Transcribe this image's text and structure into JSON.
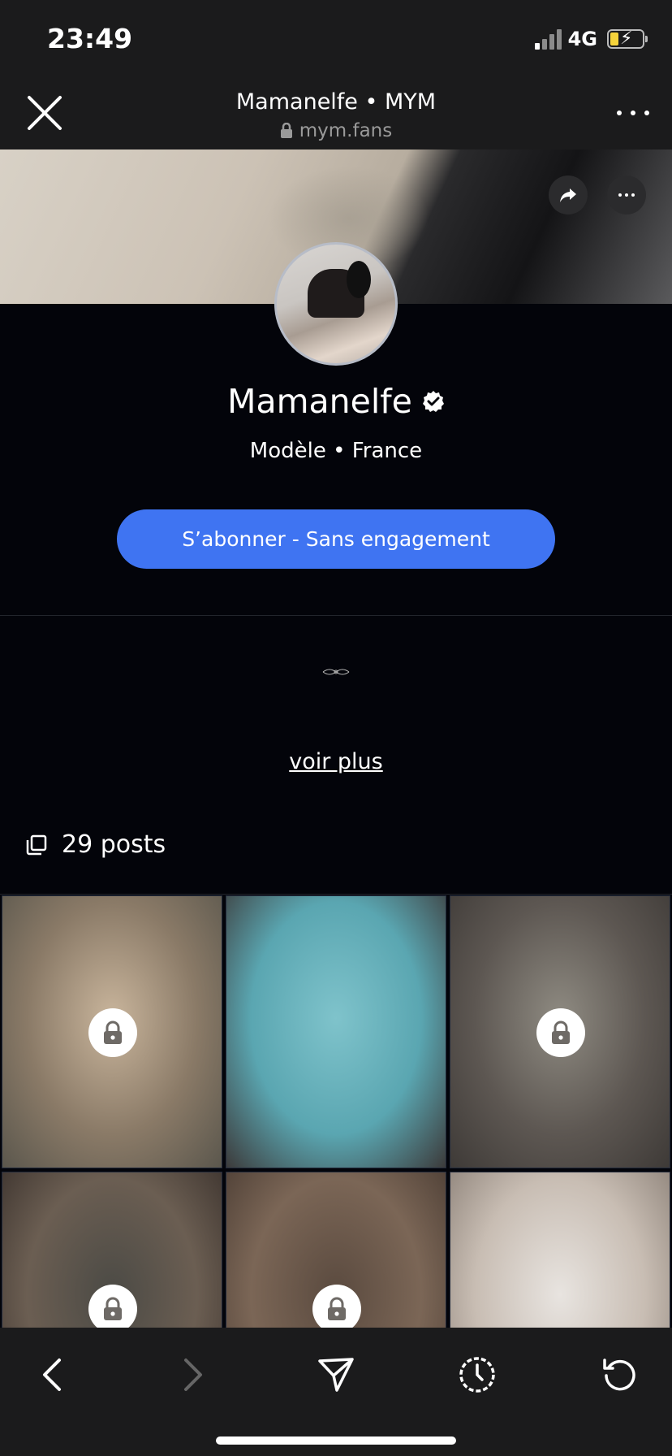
{
  "status": {
    "time": "23:49",
    "network": "4G"
  },
  "browser": {
    "title": "Mamanelfe • MYM",
    "url": "mym.fans"
  },
  "profile": {
    "name": "Mamanelfe",
    "subtitle": "Modèle • France",
    "subscribe_label": "S’abonner - Sans engagement",
    "bio_more": "voir plus",
    "posts_count": "29 posts"
  },
  "grid": {
    "items": [
      {
        "locked": true,
        "colors": [
          "#c9b59c",
          "#8a7a67",
          "#5b574d"
        ]
      },
      {
        "locked": false,
        "colors": [
          "#7fc3cb",
          "#5aa6b1",
          "#3c3a3a"
        ]
      },
      {
        "locked": true,
        "colors": [
          "#8f8b82",
          "#5d5752",
          "#3e3a37"
        ]
      },
      {
        "locked": true,
        "colors": [
          "#4b4a45",
          "#6b5e52",
          "#3a312c"
        ]
      },
      {
        "locked": true,
        "colors": [
          "#5a4a3f",
          "#7b6656",
          "#4a3c33"
        ]
      },
      {
        "locked": false,
        "colors": [
          "#e8e4e0",
          "#c8bdb3",
          "#8a7f76"
        ]
      }
    ]
  },
  "colors": {
    "accent": "#3f74f2",
    "background": "#03040a",
    "chrome": "#1b1b1c"
  },
  "icons": [
    "close-icon",
    "lock-icon",
    "more-icon",
    "share-icon",
    "verified-badge-icon",
    "posts-icon",
    "back-icon",
    "forward-icon",
    "send-icon",
    "history-icon",
    "reload-icon"
  ]
}
